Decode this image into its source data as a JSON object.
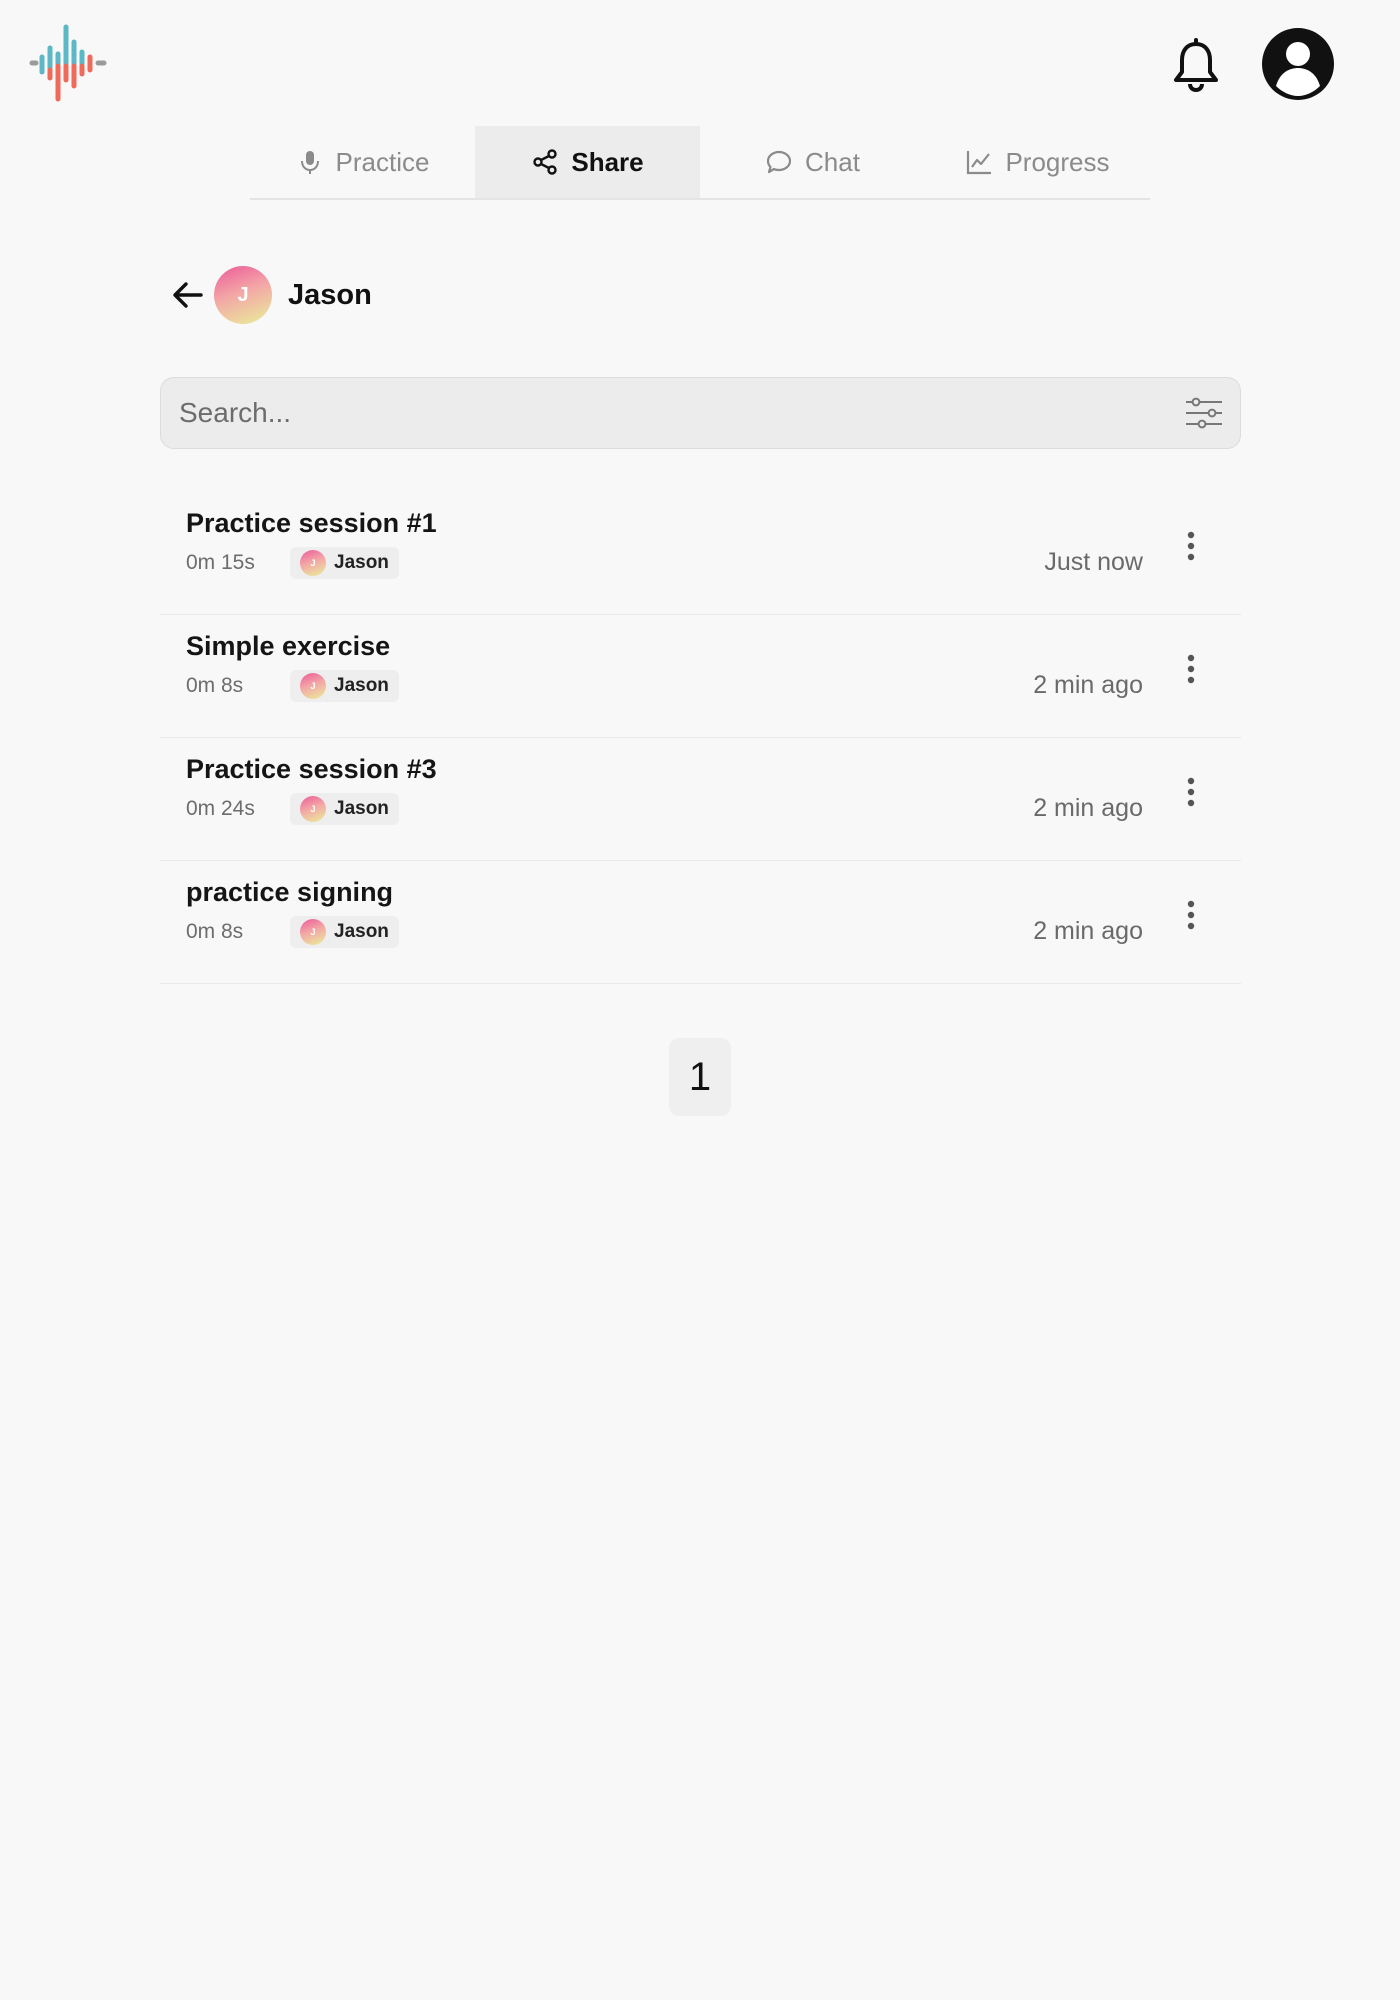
{
  "tabs": [
    {
      "label": "Practice",
      "icon": "microphone-icon",
      "active": false
    },
    {
      "label": "Share",
      "icon": "share-icon",
      "active": true
    },
    {
      "label": "Chat",
      "icon": "chat-bubble-icon",
      "active": false
    },
    {
      "label": "Progress",
      "icon": "line-chart-icon",
      "active": false
    }
  ],
  "user": {
    "name": "Jason",
    "initial": "J"
  },
  "search": {
    "placeholder": "Search..."
  },
  "items": [
    {
      "title": "Practice session #1",
      "duration": "0m 15s",
      "owner": "Jason",
      "owner_initial": "J",
      "time": "Just now"
    },
    {
      "title": "Simple exercise",
      "duration": "0m 8s",
      "owner": "Jason",
      "owner_initial": "J",
      "time": "2 min ago"
    },
    {
      "title": "Practice session #3",
      "duration": "0m 24s",
      "owner": "Jason",
      "owner_initial": "J",
      "time": "2 min ago"
    },
    {
      "title": "practice signing",
      "duration": "0m 8s",
      "owner": "Jason",
      "owner_initial": "J",
      "time": "2 min ago"
    }
  ],
  "pagination": {
    "current_page": "1"
  },
  "colors": {
    "background": "#f8f8f8",
    "active_tab_bg": "#ececec",
    "logo_teal": "#5cb8c4",
    "logo_coral": "#ee6a5a",
    "avatar_gradient_start": "#ec5a9a",
    "avatar_gradient_end": "#e9ef9a"
  }
}
